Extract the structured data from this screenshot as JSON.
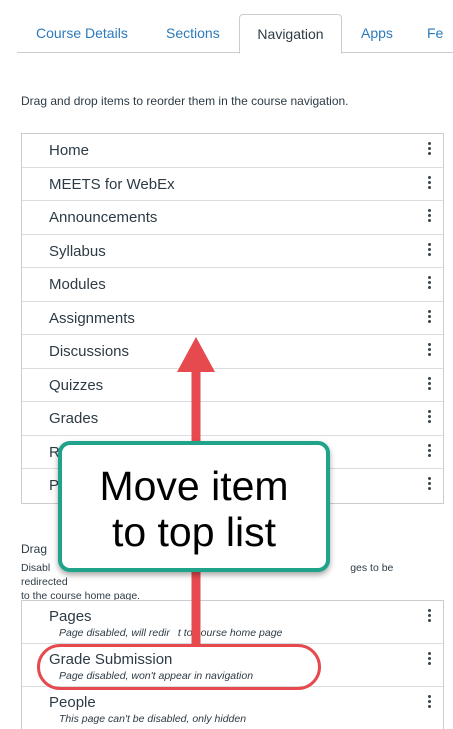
{
  "tabs": [
    {
      "label": "Course Details"
    },
    {
      "label": "Sections"
    },
    {
      "label": "Navigation"
    },
    {
      "label": "Apps"
    },
    {
      "label": "Fe"
    }
  ],
  "instructions": "Drag and drop items to reorder them in the course navigation.",
  "nav_items": [
    {
      "label": "Home"
    },
    {
      "label": "MEETS for WebEx"
    },
    {
      "label": "Announcements"
    },
    {
      "label": "Syllabus"
    },
    {
      "label": "Modules"
    },
    {
      "label": "Assignments"
    },
    {
      "label": "Discussions"
    },
    {
      "label": "Quizzes"
    },
    {
      "label": "Grades"
    },
    {
      "label": "R"
    },
    {
      "label": "P"
    }
  ],
  "disabled_section": {
    "title": "Drag",
    "desc_start": "Disabl",
    "desc_end": "ges to be redirected",
    "desc_line2": "to the course home page."
  },
  "disabled_items": [
    {
      "label": "Pages",
      "sub": "Page disabled, will redir",
      "sub_rest": "t to course home page"
    },
    {
      "label": "Grade Submission",
      "sub": "Page disabled, won't appear in navigation",
      "sub_rest": ""
    },
    {
      "label": "People",
      "sub": "This page can't be disabled, only hidden",
      "sub_rest": ""
    }
  ],
  "callout": {
    "line1": "Move item",
    "line2": "to top list"
  },
  "colors": {
    "accent_green": "#1fa38b",
    "accent_red": "#e6494e",
    "link_blue": "#2b7abc"
  }
}
